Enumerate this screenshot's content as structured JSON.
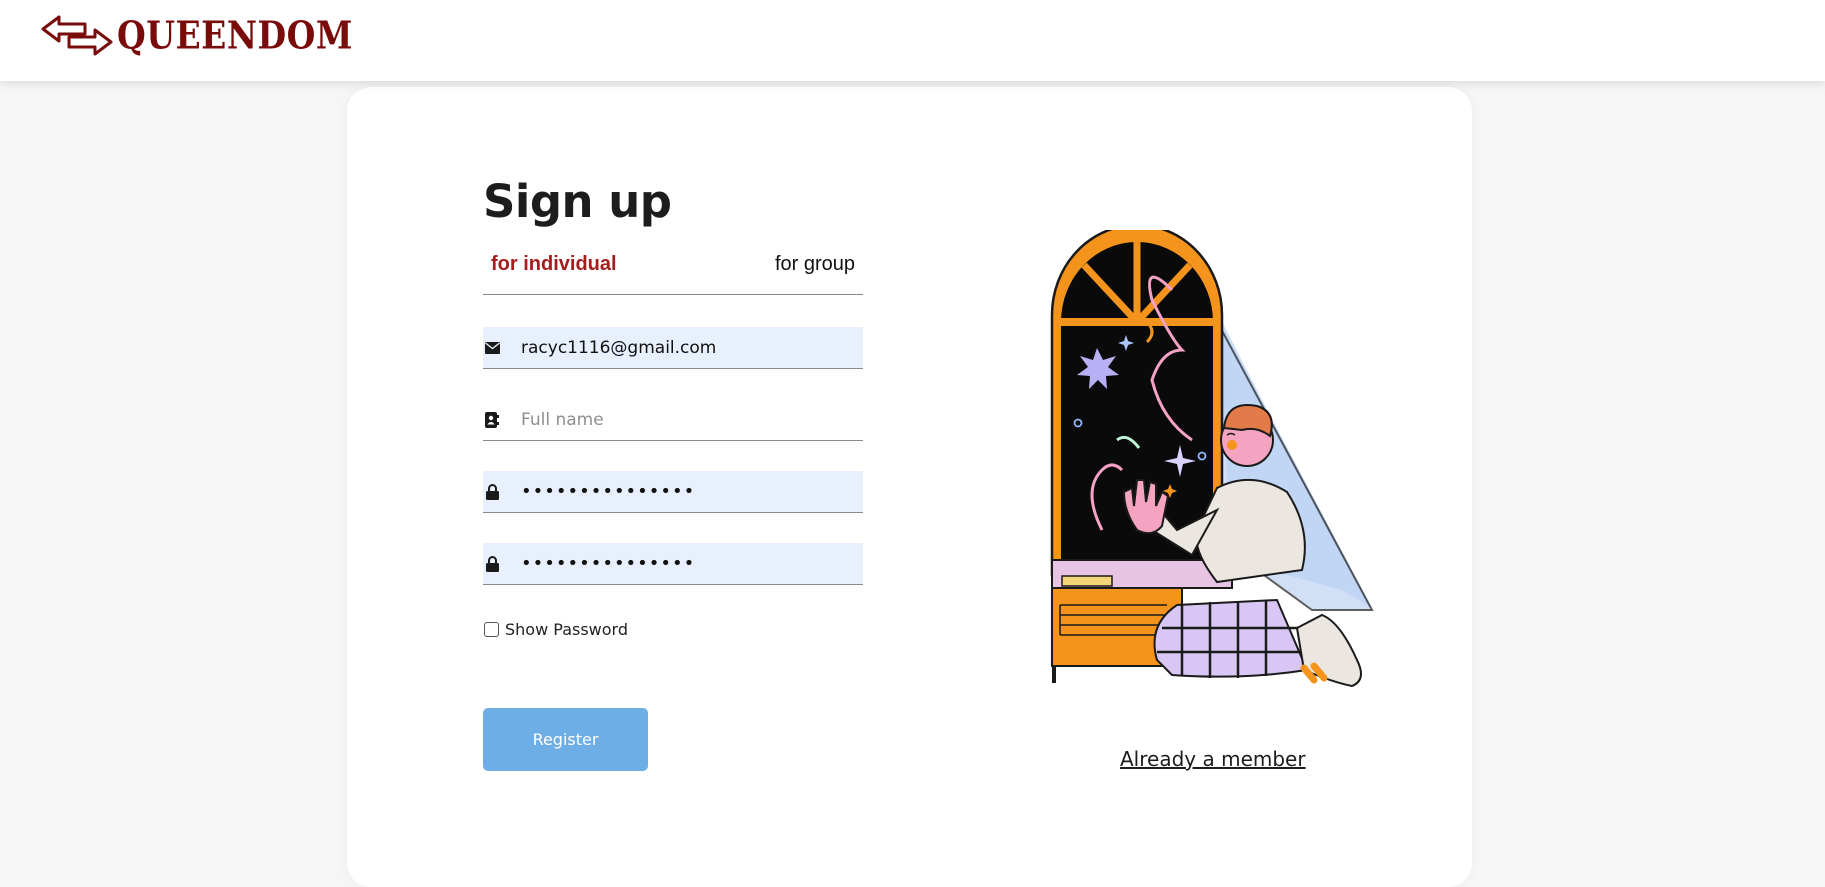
{
  "brand": {
    "name": "QUEENDOM",
    "icon": "left-right-arrows-icon",
    "color": "#7a0b0b"
  },
  "form": {
    "title": "Sign up",
    "tabs": [
      {
        "label": "for individual",
        "active": true
      },
      {
        "label": "for group",
        "active": false
      }
    ],
    "email": {
      "icon": "envelope-icon",
      "value": "racyc1116@gmail.com"
    },
    "fullname": {
      "icon": "contact-card-icon",
      "placeholder": "Full name",
      "value": ""
    },
    "password": {
      "icon": "lock-icon",
      "value": "•••••••••••••••"
    },
    "confirm_password": {
      "icon": "lock-icon",
      "value": "•••••••••••••••"
    },
    "show_password_label": "Show Password",
    "show_password_checked": false,
    "register_label": "Register"
  },
  "already_member_label": "Already a member",
  "colors": {
    "accent": "#a51d1d",
    "button": "#6eaee6",
    "input_fill": "#e8effd",
    "illustration_orange": "#f5941d",
    "illustration_night": "#0a0a0a",
    "illustration_lavender": "#d9c6f5"
  }
}
